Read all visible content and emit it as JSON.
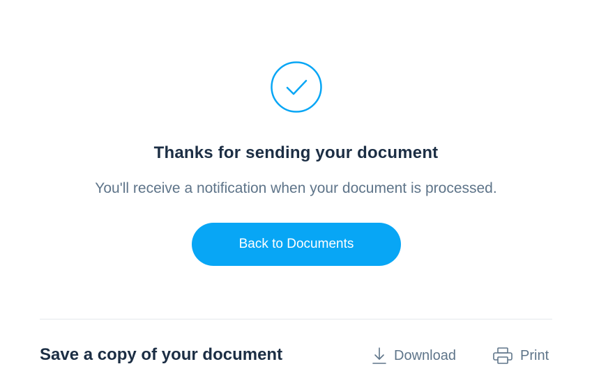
{
  "confirmation": {
    "icon": "check-circle-icon",
    "title": "Thanks for sending your document",
    "message": "You'll receive a notification when your document is processed.",
    "primary_button": "Back to Documents"
  },
  "footer": {
    "title": "Save a copy of your document",
    "actions": [
      {
        "label": "Download",
        "icon": "download-icon"
      },
      {
        "label": "Print",
        "icon": "printer-icon"
      }
    ]
  },
  "colors": {
    "accent": "#08a6f5",
    "heading": "#1c2e44",
    "muted": "#5e7489",
    "divider": "#e3e8ec"
  }
}
